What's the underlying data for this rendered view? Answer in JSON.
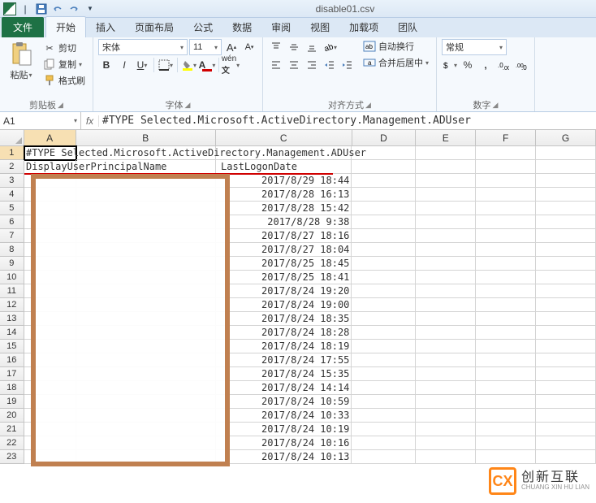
{
  "window": {
    "title": "disable01.csv"
  },
  "tabs": {
    "file": "文件",
    "home": "开始",
    "insert": "插入",
    "layout": "页面布局",
    "formulas": "公式",
    "data": "数据",
    "review": "审阅",
    "view": "视图",
    "addins": "加载项",
    "team": "团队"
  },
  "ribbon": {
    "clipboard": {
      "label": "剪贴板",
      "paste": "粘贴",
      "cut": "剪切",
      "copy": "复制",
      "format": "格式刷"
    },
    "font": {
      "label": "字体",
      "name": "宋体",
      "size": "11",
      "bold": "B",
      "italic": "I",
      "underline": "U"
    },
    "align": {
      "label": "对齐方式",
      "wrap": "自动换行",
      "merge": "合并后居中"
    },
    "number": {
      "label": "数字",
      "format": "常规"
    }
  },
  "namebox": "A1",
  "formula": "#TYPE Selected.Microsoft.ActiveDirectory.Management.ADUser",
  "cols": {
    "A": 65,
    "B": 175,
    "C": 170,
    "D": 80,
    "E": 75,
    "F": 75,
    "G": 75
  },
  "headers": [
    "A",
    "B",
    "C",
    "D",
    "E",
    "F",
    "G"
  ],
  "r1": "#TYPE Selected.Microsoft.ActiveDirectory.Management.ADUser",
  "r2a": "DisplayUserPrincipalName",
  "r2c": "LastLogonDate",
  "dates": [
    "2017/8/29 18:44",
    "2017/8/28 16:13",
    "2017/8/28 15:42",
    "2017/8/28 9:38",
    "2017/8/27 18:16",
    "2017/8/27 18:04",
    "2017/8/25 18:45",
    "2017/8/25 18:41",
    "2017/8/24 19:20",
    "2017/8/24 19:00",
    "2017/8/24 18:35",
    "2017/8/24 18:28",
    "2017/8/24 18:19",
    "2017/8/24 17:55",
    "2017/8/24 15:35",
    "2017/8/24 14:14",
    "2017/8/24 10:59",
    "2017/8/24 10:33",
    "2017/8/24 10:19",
    "2017/8/24 10:16",
    "2017/8/24 10:13"
  ],
  "watermark": {
    "brand": "创新互联",
    "sub": "CHUANG XIN HU LIAN",
    "logo": "CX"
  }
}
